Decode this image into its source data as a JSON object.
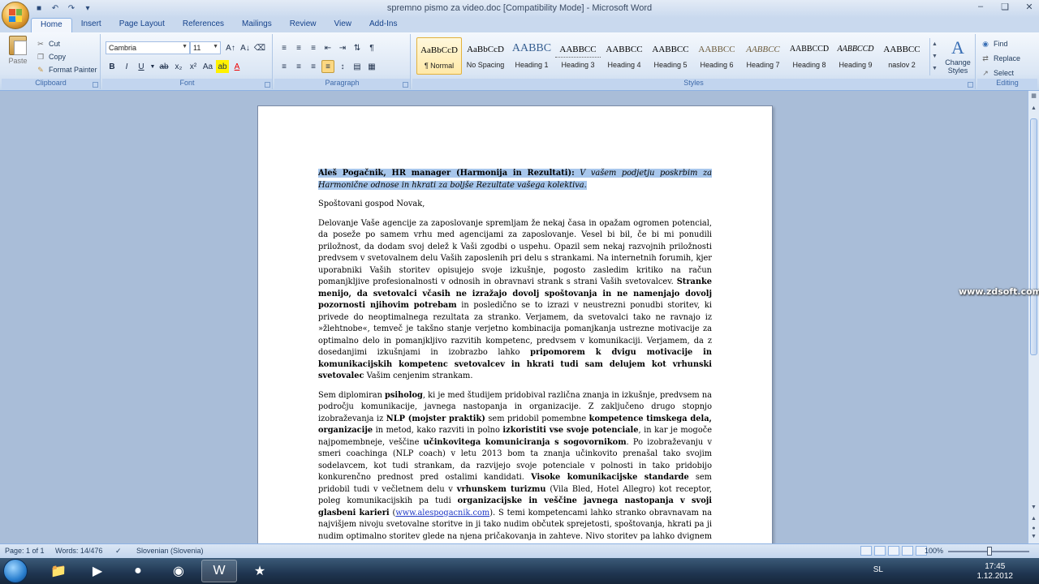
{
  "window": {
    "title": "spremno pismo za video.doc [Compatibility Mode] - Microsoft Word"
  },
  "tabs": [
    "Home",
    "Insert",
    "Page Layout",
    "References",
    "Mailings",
    "Review",
    "View",
    "Add-Ins"
  ],
  "ribbon": {
    "clipboard": {
      "paste_label": "Paste",
      "cut_label": "Cut",
      "copy_label": "Copy",
      "format_painter_label": "Format Painter",
      "group_label": "Clipboard"
    },
    "font": {
      "font_name": "Cambria",
      "font_size": "11",
      "group_label": "Font"
    },
    "paragraph": {
      "group_label": "Paragraph"
    },
    "styles": {
      "group_label": "Styles",
      "items": [
        {
          "sample": "AaBbCcD",
          "name": "¶ Normal"
        },
        {
          "sample": "AaBbCcD",
          "name": "No Spacing"
        },
        {
          "sample": "AABBC",
          "name": "Heading 1"
        },
        {
          "sample": "AABBCC",
          "name": "Heading 3"
        },
        {
          "sample": "AABBCC",
          "name": "Heading 4"
        },
        {
          "sample": "AABBCC",
          "name": "Heading 5"
        },
        {
          "sample": "AABBCC",
          "name": "Heading 6"
        },
        {
          "sample": "AABBCC",
          "name": "Heading 7"
        },
        {
          "sample": "AABBCCD",
          "name": "Heading 8"
        },
        {
          "sample": "AABBCCD",
          "name": "Heading 9"
        },
        {
          "sample": "AABBCC",
          "name": "naslov 2"
        }
      ],
      "change_styles_label": "Change Styles"
    },
    "editing": {
      "find_label": "Find",
      "replace_label": "Replace",
      "select_label": "Select",
      "group_label": "Editing"
    }
  },
  "document": {
    "heading_bold": "Aleš Pogačnik, HR manager (Harmonija in Rezultati):",
    "heading_italic": "V vašem podjetju poskrbim za Harmonične odnose in hkrati za boljše Rezultate vašega kolektiva.",
    "greeting": "Spoštovani gospod Novak,",
    "p1_a": "Delovanje Vaše agencije za zaposlovanje spremljam že nekaj časa in opažam ogromen potencial, da poseže po samem vrhu med agencijami za zaposlovanje. Vesel bi bil, če bi mi ponudili priložnost, da dodam svoj delež k Vaši zgodbi o uspehu. Opazil sem nekaj razvojnih priložnosti predvsem v svetovalnem delu Vaših zaposlenih pri delu s strankami. Na internetnih forumih, kjer uporabniki Vaših storitev opisujejo svoje izkušnje, pogosto zasledim kritiko na račun pomanjkljive profesionalnosti v odnosih in obravnavi strank s strani Vaših svetovalcev.",
    "p1_b": "Stranke menijo, da svetovalci včasih ne izražajo dovolj spoštovanja in ne namenjajo dovolj pozornosti njihovim potrebam",
    "p1_c": "in posledično se to izrazi v neustrezni ponudbi storitev, ki privede do neoptimalnega rezultata za stranko. Verjamem, da svetovalci tako ne ravnajo iz »žlehtnobe«, temveč je takšno stanje verjetno kombinacija pomanjkanja ustrezne motivacije za optimalno delo in pomanjkljivo razvitih kompetenc, predvsem v komunikaciji. Verjamem, da z dosedanjimi izkušnjami in izobrazbo lahko",
    "p1_d": "pripomorem k dvigu motivacije in komunikacijskih kompetenc svetovalcev in hkrati tudi sam delujem kot vrhunski svetovalec",
    "p1_e": "Vašim cenjenim strankam.",
    "p2_a": "Sem diplomiran",
    "p2_b": "psiholog",
    "p2_c": ", ki je med študijem pridobival različna znanja in izkušnje, predvsem na področju komunikacije, javnega nastopanja in organizacije. Z zaključeno drugo stopnjo izobraževanja iz",
    "p2_d": "NLP (mojster praktik)",
    "p2_e": "sem pridobil pomembne",
    "p2_f": "kompetence timskega dela, organizacije",
    "p2_g": "in metod, kako razviti in polno",
    "p2_h": "izkoristiti vse svoje potenciale",
    "p2_i": ", in kar je mogoče najpomembneje, veščine",
    "p2_j": "učinkovitega komuniciranja s sogovornikom",
    "p2_k": ". Po izobraževanju v smeri coachinga (NLP coach) v letu 2013 bom ta znanja učinkovito prenašal tako svojim sodelavcem, kot tudi strankam, da razvijejo svoje potenciale v polnosti in tako pridobijo konkurenčno prednost pred ostalimi kandidati.",
    "p2_l": "Visoke komunikacijske standarde",
    "p2_m": "sem pridobil tudi v večletnem delu v",
    "p2_n": "vrhunskem turizmu",
    "p2_o": "(Vila Bled, Hotel Allegro) kot receptor, poleg komunikacijskih pa tudi",
    "p2_p": "organizacijske in veščine javnega nastopanja v svoji glasbeni karieri",
    "p2_q": "(",
    "p2_link": "www.alespogacnik.com",
    "p2_r": "). S temi kompetencami lahko stranko obravnavam na najvišjem nivoju svetovalne storitve in ji tako nudim občutek sprejetosti, spoštovanja, hkrati pa ji nudim optimalno storitev glede na njena pričakovanja in zahteve. Nivo storitev pa lahko dvignem še z"
  },
  "watermark": "www.zdsoft.com",
  "statusbar": {
    "page": "Page: 1 of 1",
    "words": "Words: 14/476",
    "language": "Slovenian (Slovenia)",
    "zoom": "100%"
  },
  "taskbar": {
    "lang": "SL",
    "time": "17:45",
    "date": "1.12.2012"
  }
}
